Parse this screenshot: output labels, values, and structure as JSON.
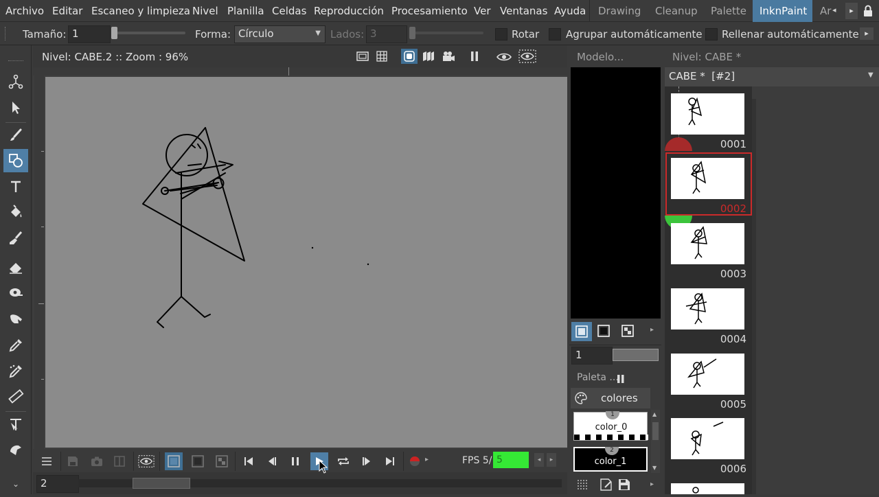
{
  "menubar": {
    "items": [
      "Archivo",
      "Editar",
      "Escaneo y limpieza",
      "Nivel",
      "Planilla",
      "Celdas",
      "Reproducción",
      "Procesamiento",
      "Ver",
      "Ventanas",
      "Ayuda"
    ],
    "rooms": [
      "Drawing",
      "Cleanup",
      "Palette",
      "InknPaint",
      "Ar"
    ],
    "active_room": "InknPaint"
  },
  "tool_options": {
    "size_label": "Tamaño:",
    "size_value": "1",
    "shape_label": "Forma:",
    "shape_value": "Círculo",
    "sides_label": "Lados:",
    "sides_value": "3",
    "rotate_label": "Rotar",
    "autogroup_label": "Agrupar automáticamente",
    "autofill_label": "Rellenar automáticamente"
  },
  "toolbar": {
    "tools": [
      "animate-tool",
      "selection-tool",
      "brush-tool",
      "geometric-tool",
      "type-tool",
      "fill-tool",
      "paint-brush-tool",
      "eraser-tool",
      "tape-tool",
      "finger-tool",
      "style-picker-tool",
      "rgb-picker-tool",
      "ruler-tool",
      "control-point-editor-tool",
      "pump-tool"
    ],
    "active_tool": "geometric-tool"
  },
  "viewer": {
    "title": "Nivel: CABE.2  ::  Zoom : 96%",
    "frame_field": "2"
  },
  "playback": {
    "fps_label": "FPS 5/",
    "fps_value": "5"
  },
  "model_panel": {
    "title": "Modelo..."
  },
  "style_panel": {
    "frame_value": "1",
    "palette_title": "Paleta ...",
    "palette_name": "colores",
    "chips": [
      {
        "index": "1",
        "name": "color_0"
      },
      {
        "index": "2",
        "name": "color_1"
      }
    ]
  },
  "level_strip": {
    "title": "Nivel: CABE *",
    "level_name": "CABE *  [#2]",
    "frames": [
      "0001",
      "0002",
      "0003",
      "0004",
      "0005",
      "0006"
    ],
    "selected_frame": "0002",
    "selected_color": "#cc2a2a"
  }
}
